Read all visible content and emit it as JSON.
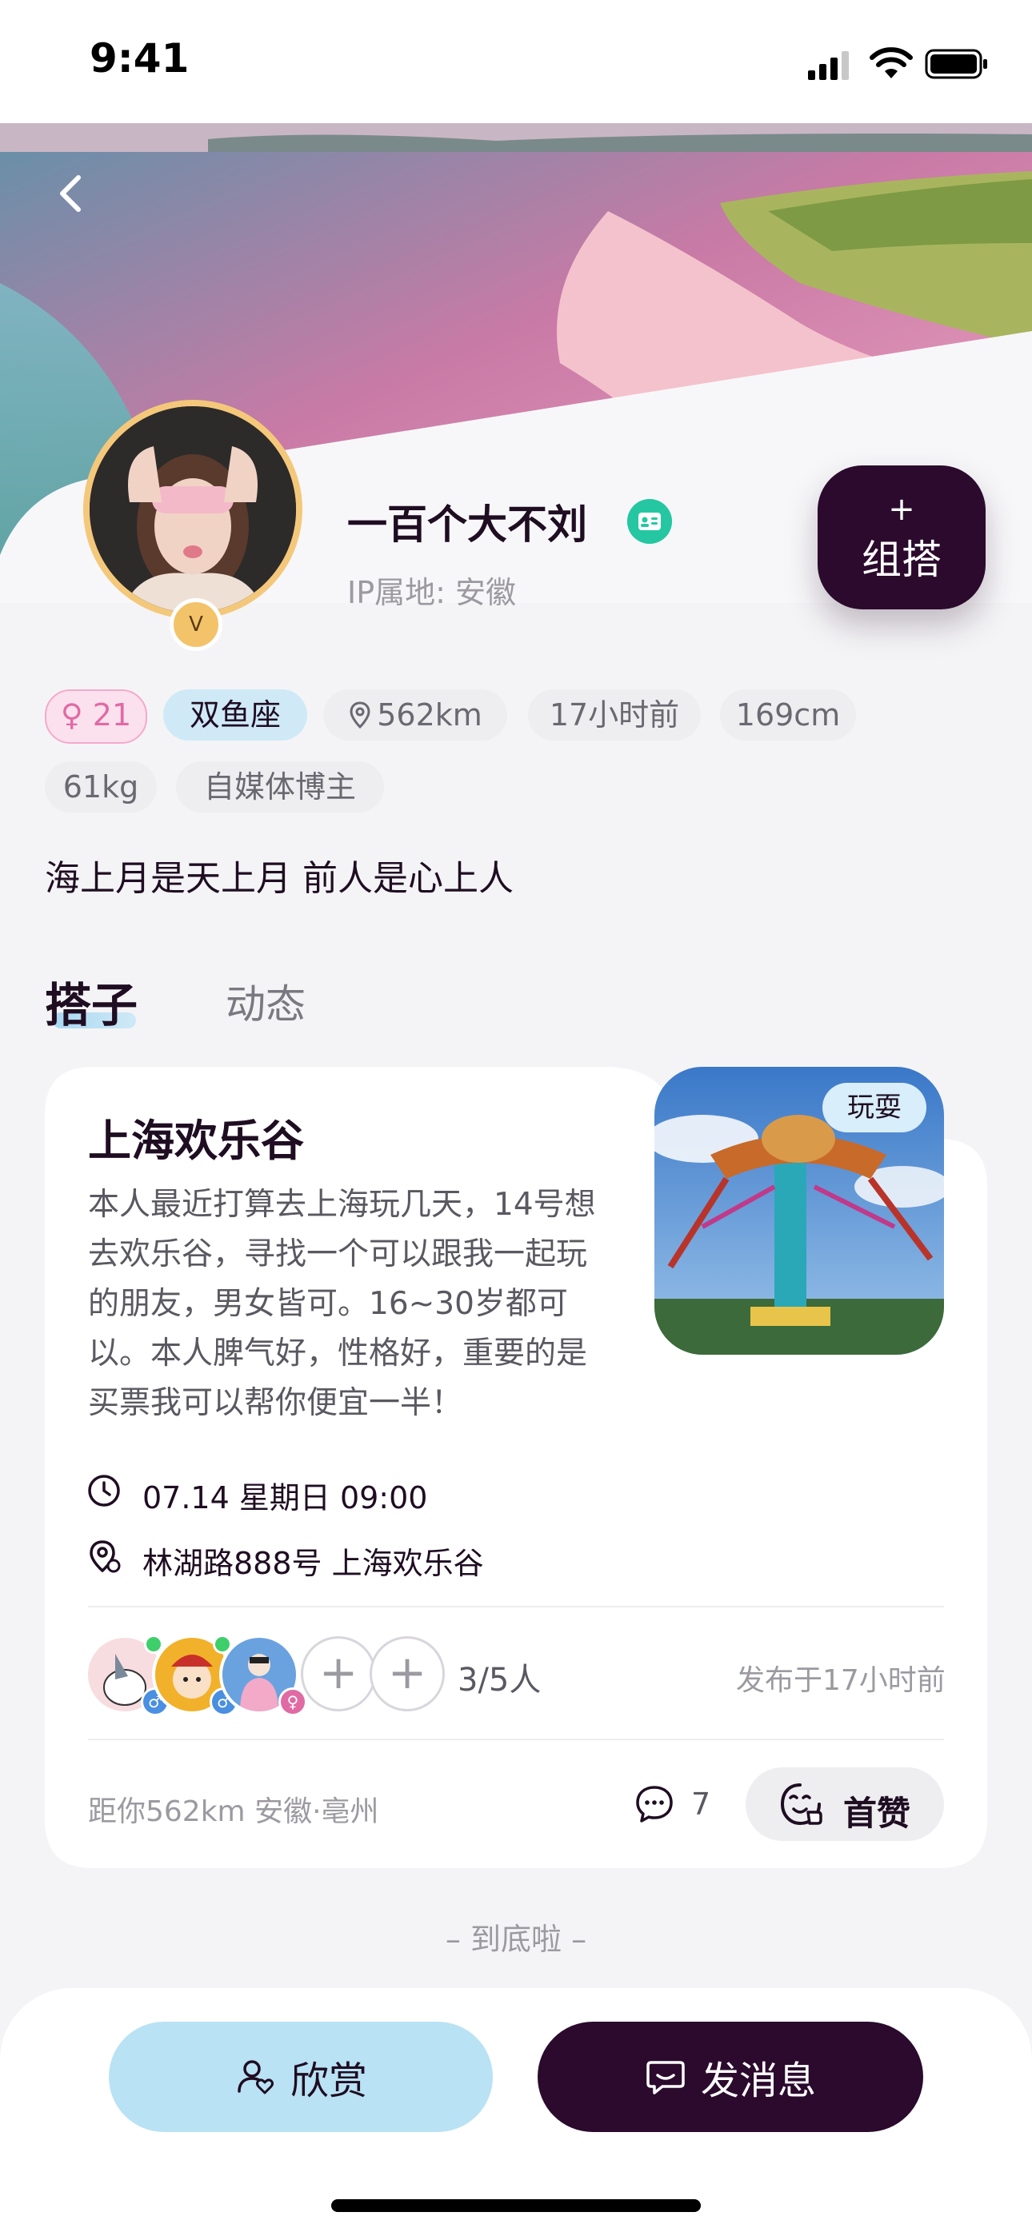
{
  "status_bar": {
    "time": "9:41"
  },
  "profile": {
    "name": "一百个大不刘",
    "ip_location": "IP属地: 安徽",
    "avatar_badge": "V",
    "create_button": {
      "plus": "+",
      "label": "组搭"
    },
    "tags": {
      "gender_age": "♀ 21",
      "zodiac": "双鱼座",
      "distance": "562km",
      "last_active": "17小时前",
      "height": "169cm",
      "weight": "61kg",
      "occupation": "自媒体博主"
    },
    "bio": "海上月是天上月 前人是心上人"
  },
  "tabs": [
    {
      "label": "搭子",
      "active": true
    },
    {
      "label": "动态",
      "active": false
    }
  ],
  "post": {
    "title": "上海欢乐谷",
    "description": "本人最近打算去上海玩几天，14号想去欢乐谷，寻找一个可以跟我一起玩的朋友，男女皆可。16~30岁都可以。本人脾气好，性格好，重要的是买票我可以帮你便宜一半！",
    "category": "玩耍",
    "datetime": "07.14  星期日  09:00",
    "address": "林湖路888号 上海欢乐谷",
    "participants": "3/5人",
    "published": "发布于17小时前",
    "distance_location": "距你562km   安徽·亳州",
    "comment_count": "7",
    "like_label": "首赞"
  },
  "end_text": "– 到底啦 –",
  "bottom_actions": {
    "appreciate": "欣赏",
    "message": "发消息"
  },
  "colors": {
    "dark": "#2b0a2d",
    "light_blue": "#b9e2f4",
    "verify_green": "#25c7a2",
    "female_pink": "#e06aa4",
    "male_blue": "#4a8fe0"
  }
}
